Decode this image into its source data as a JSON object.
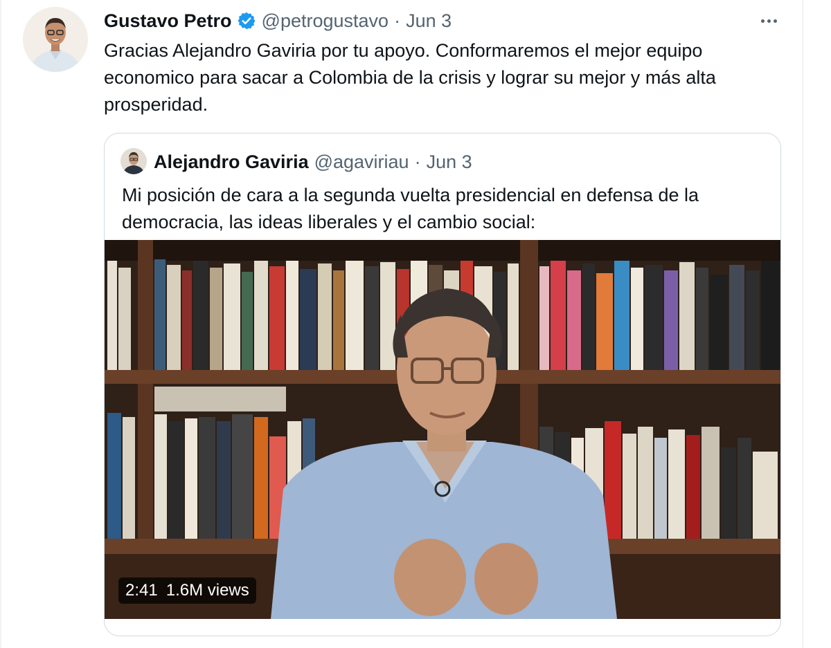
{
  "tweet": {
    "author_name": "Gustavo Petro",
    "handle": "@petrogustavo",
    "separator": "·",
    "date": "Jun 3",
    "text": "Gracias Alejandro Gaviria por tu apoyo. Conformaremos el mejor equipo economico para sacar a Colombia de la crisis y lograr su mejor y más alta prosperidad."
  },
  "quoted_tweet": {
    "author_name": "Alejandro Gaviria",
    "handle": "@agaviriau",
    "separator": "·",
    "date": "Jun 3",
    "text": "Mi posición de cara a la segunda vuelta presidencial en defensa de la democracia, las ideas liberales y el cambio social:",
    "video": {
      "duration": "2:41",
      "views": "1.6M views"
    }
  },
  "icons": {
    "verified": "verified-badge-icon",
    "more": "more-options-icon"
  },
  "colors": {
    "text_primary": "#0f1419",
    "text_secondary": "#536471",
    "verified_blue": "#1d9bf0",
    "border": "#cfd9de"
  }
}
